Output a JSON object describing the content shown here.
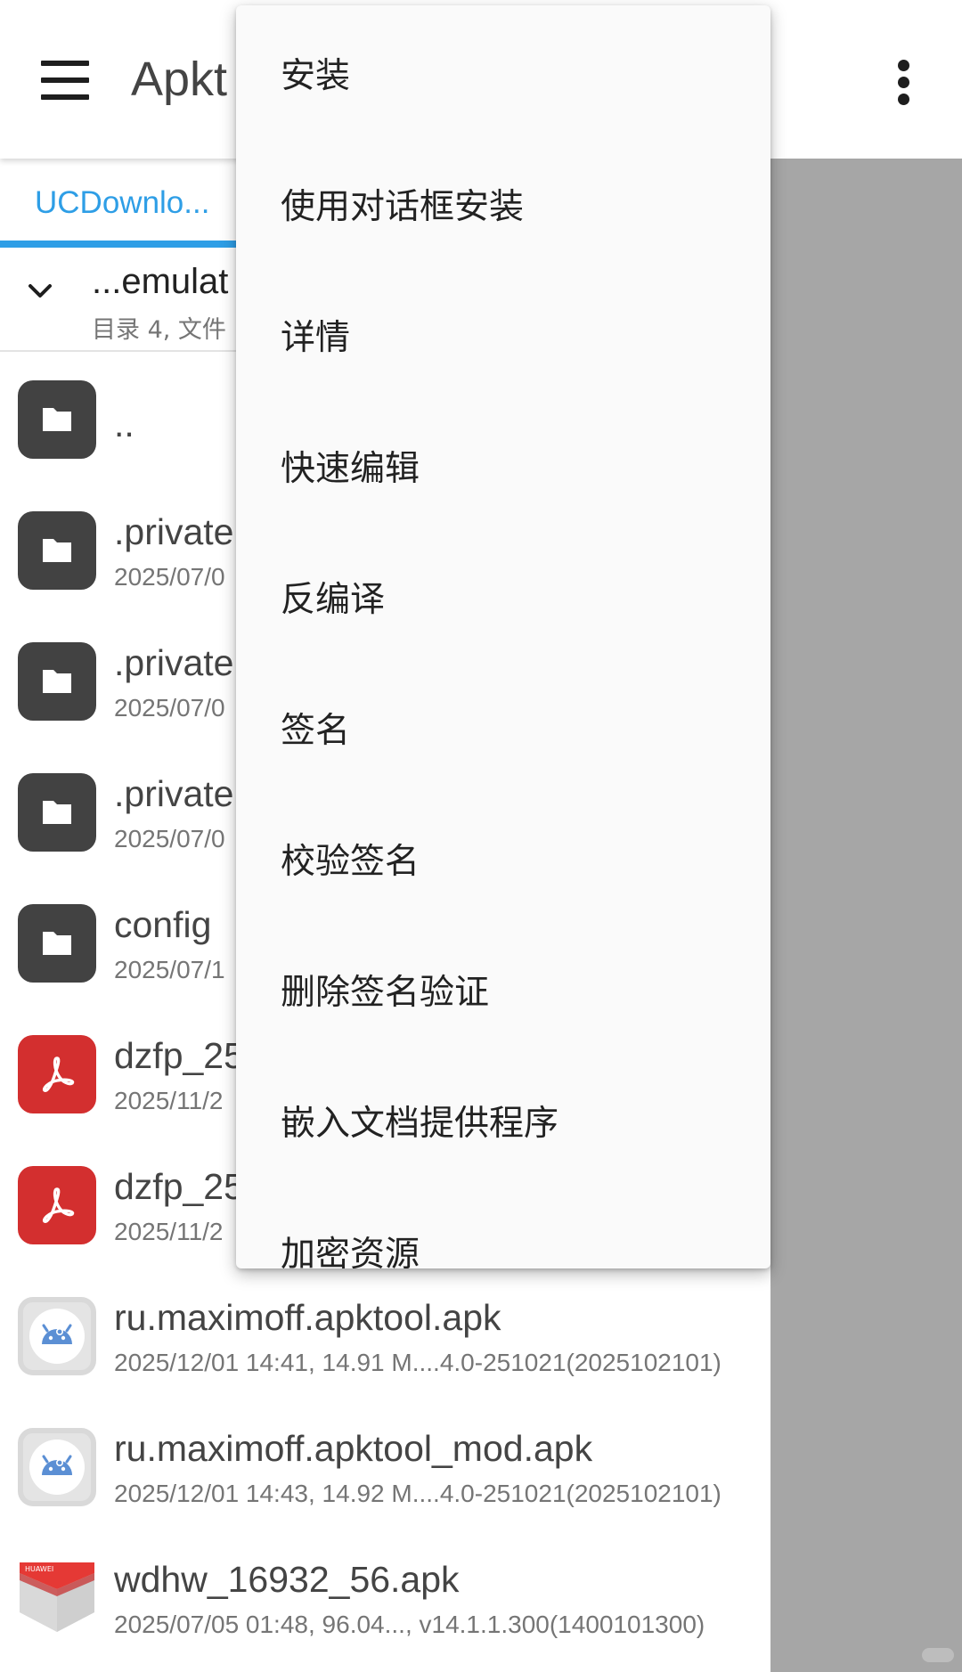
{
  "app_bar": {
    "title": "Apkt",
    "menu_icon": "hamburger-menu-icon",
    "overflow_icon": "more-vert-icon"
  },
  "tab": {
    "label": "UCDownlo..."
  },
  "path": {
    "title": "...emulat",
    "subtitle": "目录 4, 文件"
  },
  "files": [
    {
      "type": "folder",
      "name": "..",
      "meta": ""
    },
    {
      "type": "folder",
      "name": ".private",
      "meta": "2025/07/0"
    },
    {
      "type": "folder",
      "name": ".private",
      "meta": "2025/07/0"
    },
    {
      "type": "folder",
      "name": ".private",
      "meta": "2025/07/0"
    },
    {
      "type": "folder",
      "name": "config",
      "meta": "2025/07/1"
    },
    {
      "type": "pdf",
      "name": "dzfp_25",
      "meta": "2025/11/2"
    },
    {
      "type": "pdf",
      "name": "dzfp_25",
      "meta": "2025/11/2"
    },
    {
      "type": "apk",
      "name": "ru.maximoff.apktool.apk",
      "meta": "2025/12/01 14:41, 14.91 M....4.0-251021(2025102101)"
    },
    {
      "type": "apk",
      "name": "ru.maximoff.apktool_mod.apk",
      "meta": "2025/12/01 14:43, 14.92 M....4.0-251021(2025102101)"
    },
    {
      "type": "huawei",
      "name": "wdhw_16932_56.apk",
      "meta": "2025/07/05 01:48, 96.04..., v14.1.1.300(1400101300)",
      "icon_text": "HUAWEI"
    }
  ],
  "popup_menu": [
    "安装",
    "使用对话框安装",
    "详情",
    "快速编辑",
    "反编译",
    "签名",
    "校验签名",
    "删除签名验证",
    "嵌入文档提供程序",
    "加密资源"
  ],
  "colors": {
    "accent": "#2e9ee6",
    "folder_icon": "#424242",
    "pdf_icon": "#d32f2f",
    "scrim": "#a6a6a6",
    "android_blue": "#5b8fd4"
  }
}
